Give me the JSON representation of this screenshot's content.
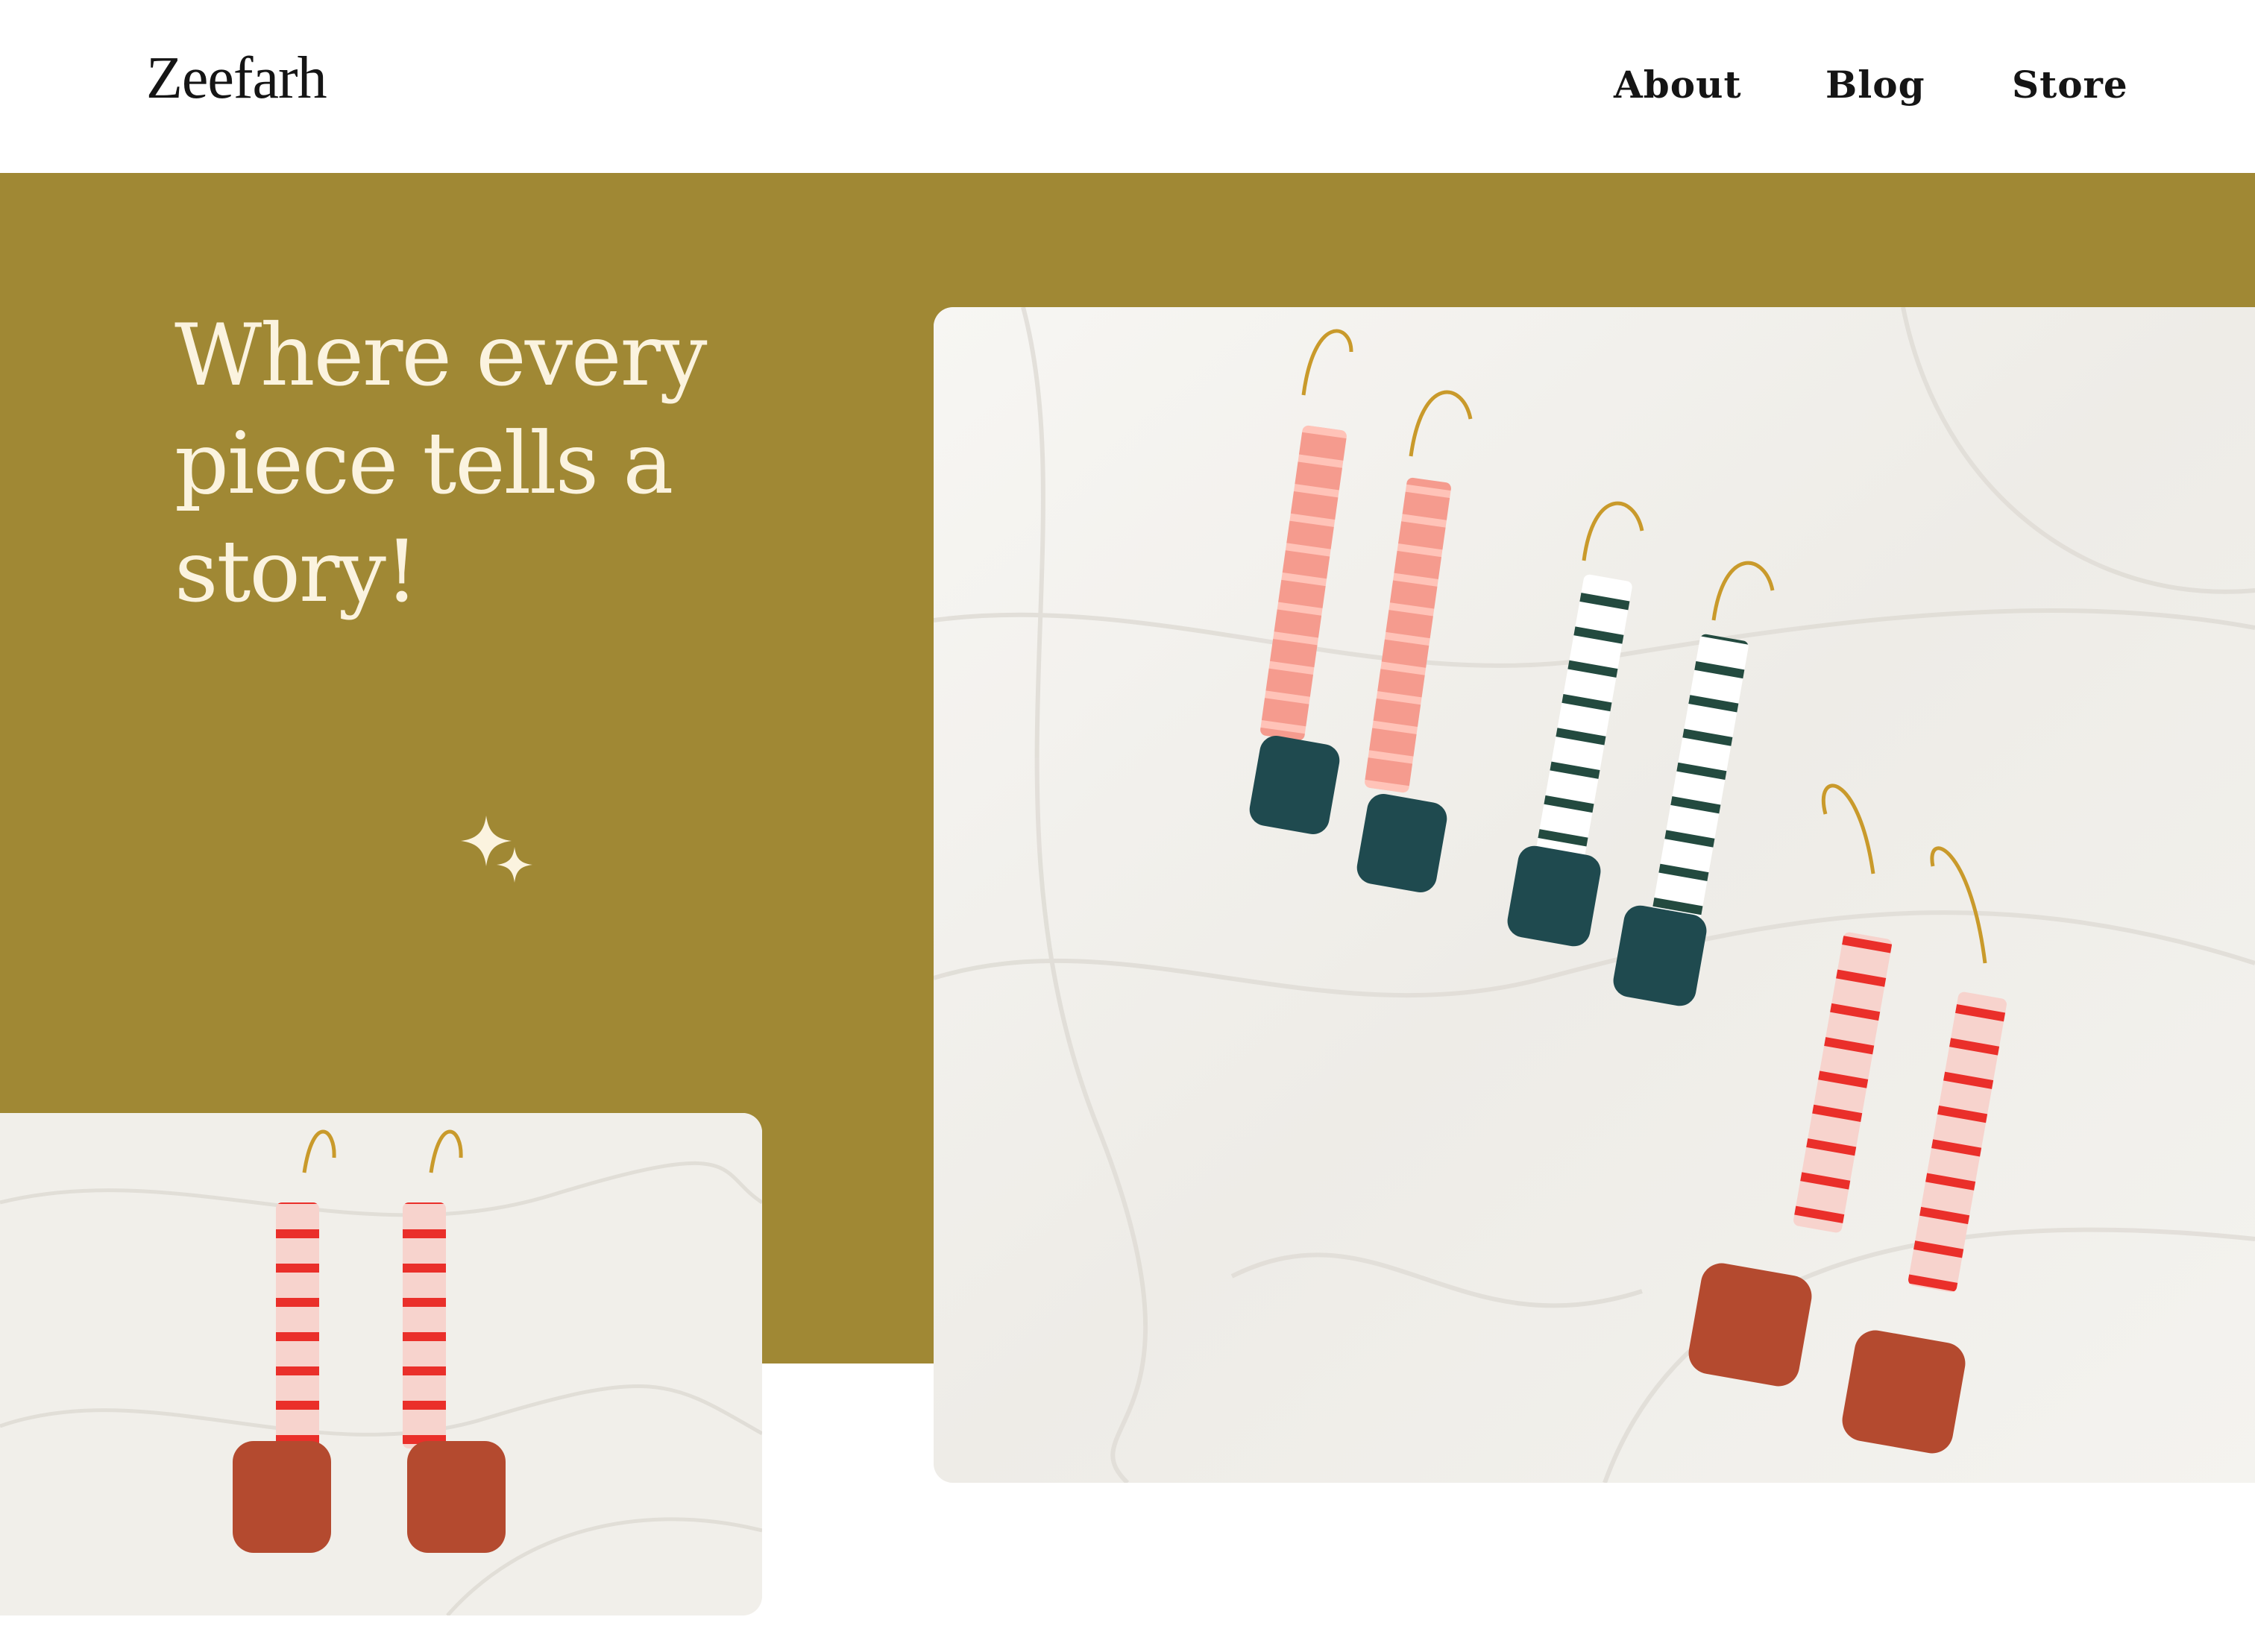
{
  "header": {
    "logo": "Zeefarh",
    "nav": [
      {
        "label": "About"
      },
      {
        "label": "Blog"
      },
      {
        "label": "Store"
      }
    ]
  },
  "hero": {
    "title": "Where every piece tells a story!",
    "sparkle_icon": "sparkle-icon"
  },
  "images": {
    "main": "earrings-trio-photo",
    "secondary": "red-earrings-photo"
  },
  "colors": {
    "band": "#a08834",
    "hero_text": "#fbf3df",
    "nav_text": "#151515",
    "background": "#ffffff"
  }
}
